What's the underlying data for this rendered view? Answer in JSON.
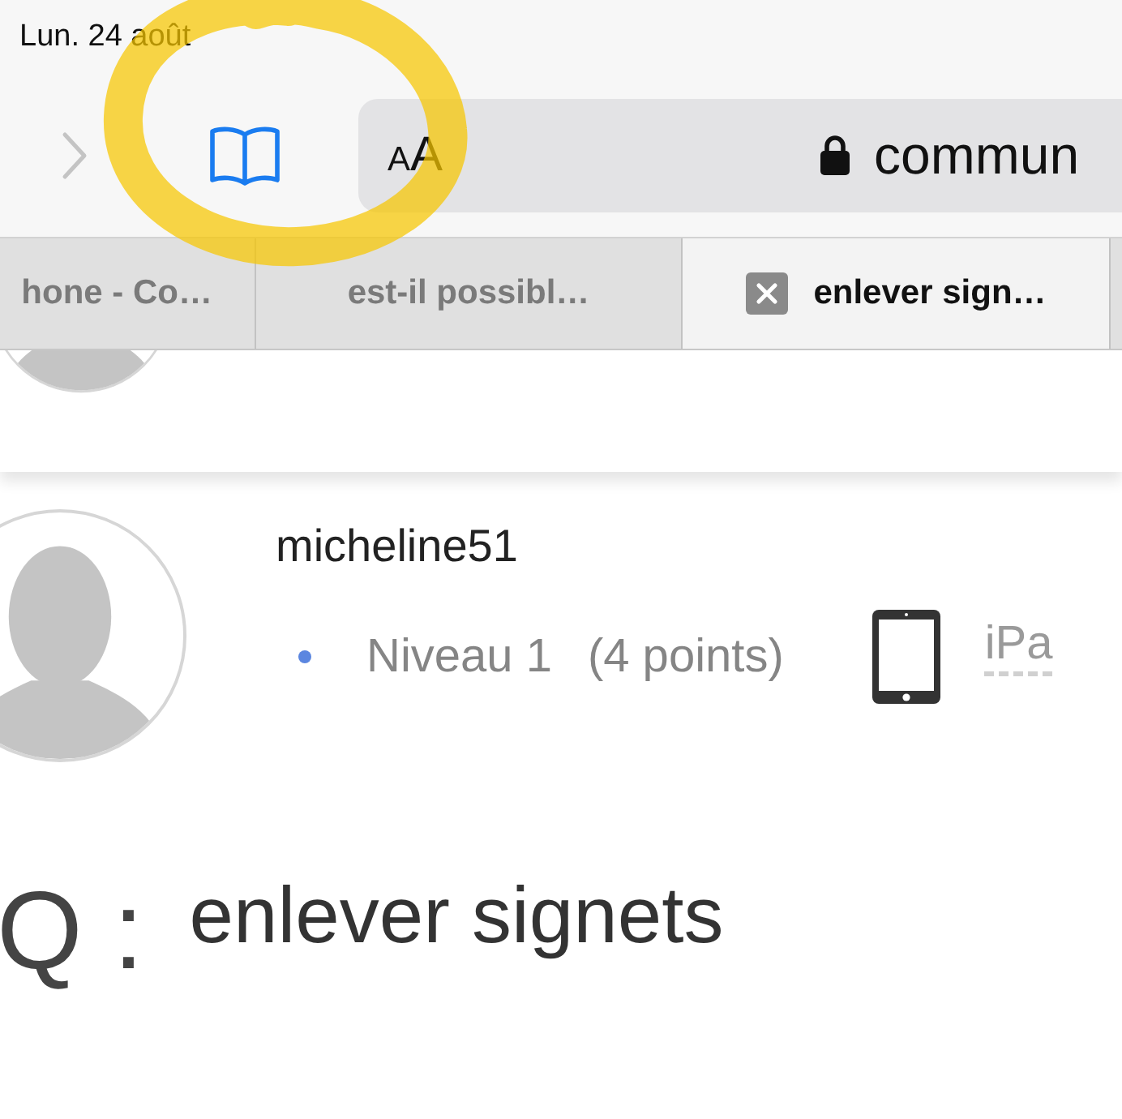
{
  "status_bar": {
    "date": "Lun. 24 août"
  },
  "toolbar": {
    "text_size_label": "AA",
    "address": "commun"
  },
  "tabs": [
    {
      "title": "hone - Co…",
      "selected": false
    },
    {
      "title": "est-il possibl…",
      "selected": false
    },
    {
      "title": "enlever sign…",
      "selected": true
    }
  ],
  "profile": {
    "username": "micheline51",
    "level": "Niveau 1",
    "points": "(4 points)",
    "device": "iPa"
  },
  "question": {
    "prefix": "Q :",
    "title": "enlever signets"
  },
  "annotation": {
    "kind": "circle"
  }
}
